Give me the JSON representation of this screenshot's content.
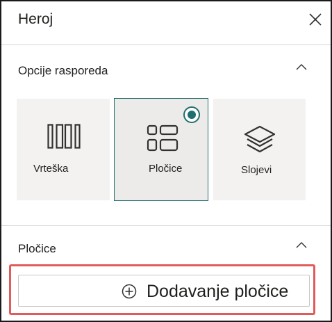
{
  "panel": {
    "title": "Heroj"
  },
  "layout_section": {
    "title": "Opcije rasporeda",
    "options": [
      {
        "label": "Vrteška",
        "icon": "carousel-icon",
        "selected": false
      },
      {
        "label": "Pločice",
        "icon": "tiles-icon",
        "selected": true
      },
      {
        "label": "Slojevi",
        "icon": "layers-icon",
        "selected": false
      }
    ]
  },
  "tiles_section": {
    "title": "Pločice",
    "add_button_label": "Dodavanje pločice",
    "add_icon": "plus-circle-icon"
  },
  "colors": {
    "accent": "#1f6e70",
    "highlight": "#e25b5b"
  }
}
